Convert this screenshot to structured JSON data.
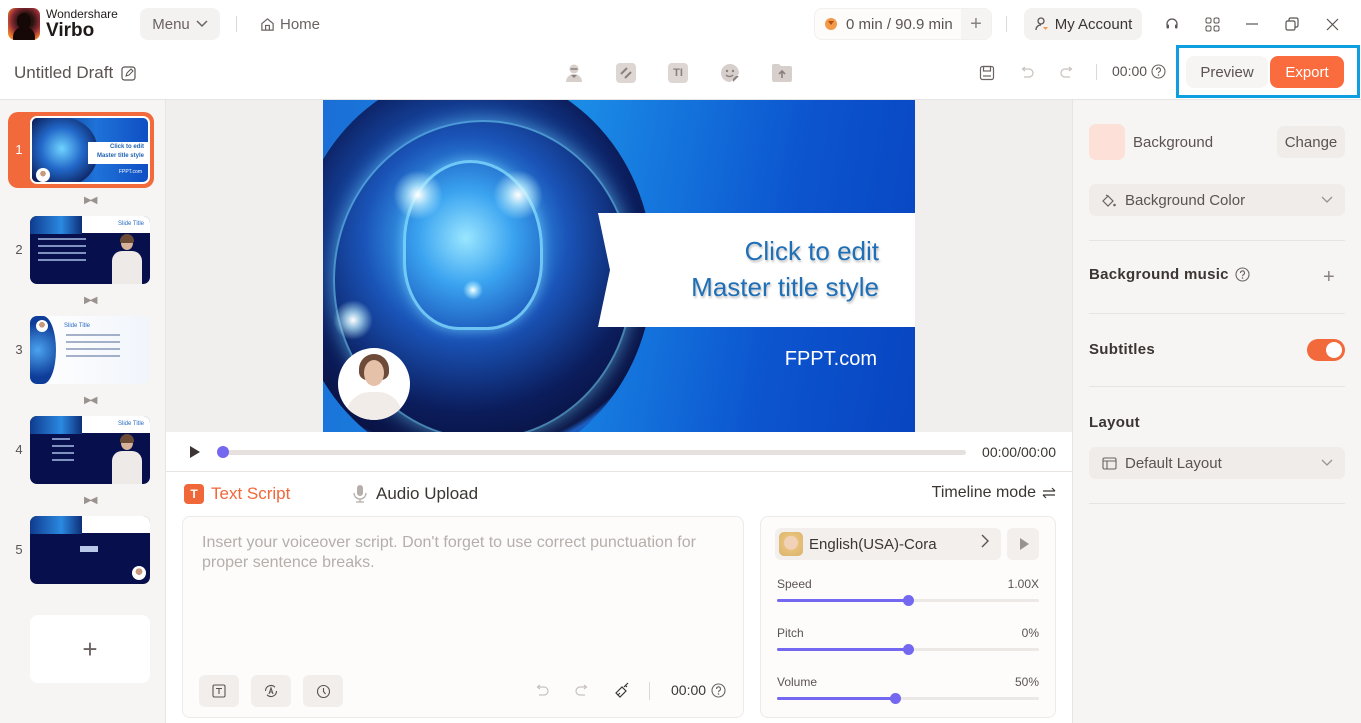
{
  "app": {
    "brand_company": "Wondershare",
    "brand_product": "Virbo",
    "menu_label": "Menu",
    "home_label": "Home",
    "credits_text": "0 min / 90.9 min",
    "account_label": "My Account"
  },
  "toolbar": {
    "draft_title": "Untitled Draft",
    "time": "00:00",
    "preview_label": "Preview",
    "export_label": "Export",
    "tools": [
      "avatar-icon",
      "background-icon",
      "text-icon",
      "sticker-icon",
      "upload-icon"
    ]
  },
  "slides": [
    {
      "number": "1",
      "active": true,
      "title": "Click to edit Master title style",
      "footer": "FPPT.com"
    },
    {
      "number": "2",
      "active": false,
      "title": "Slide Title"
    },
    {
      "number": "3",
      "active": false,
      "title": "Slide Title"
    },
    {
      "number": "4",
      "active": false,
      "title": "Slide Title"
    },
    {
      "number": "5",
      "active": false
    }
  ],
  "add_slide_label": "+",
  "canvas": {
    "title_line1": "Click to edit",
    "title_line2": "Master title style",
    "footer": "FPPT.com"
  },
  "playback": {
    "time": "00:00/00:00",
    "progress": 0
  },
  "script": {
    "tab_text": "Text Script",
    "tab_text_icon": "T",
    "tab_audio": "Audio Upload",
    "timeline_mode": "Timeline mode",
    "placeholder": "Insert your voiceover script. Don't forget to use correct punctuation for proper sentence breaks.",
    "time": "00:00"
  },
  "voice": {
    "name": "English(USA)-Cora",
    "speed": {
      "label": "Speed",
      "value": "1.00X",
      "fraction": 0.5
    },
    "pitch": {
      "label": "Pitch",
      "value": "0%",
      "fraction": 0.5
    },
    "volume": {
      "label": "Volume",
      "value": "50%",
      "fraction": 0.45
    }
  },
  "properties": {
    "background_label": "Background",
    "background_swatch": "#fde0d8",
    "change_label": "Change",
    "background_type": "Background Color",
    "music_heading": "Background music",
    "subtitles_heading": "Subtitles",
    "subtitles_on": true,
    "layout_heading": "Layout",
    "layout_value": "Default Layout"
  },
  "colors": {
    "accent": "#fa6b3d",
    "slider": "#7467f0",
    "highlight_frame": "#0f9fe0"
  }
}
